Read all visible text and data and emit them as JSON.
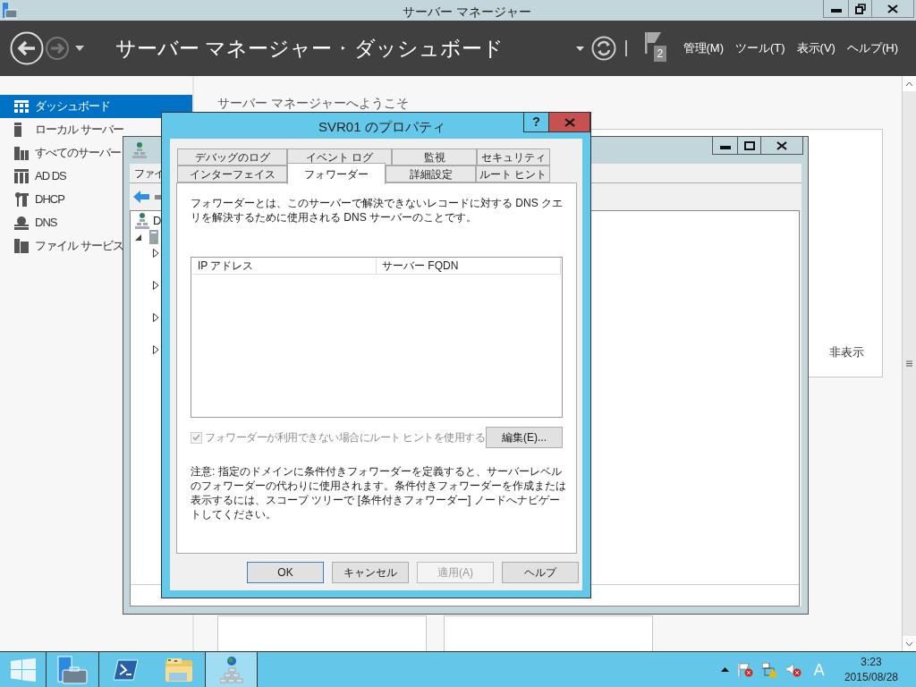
{
  "window": {
    "title": "サーバー マネージャー"
  },
  "header": {
    "breadcrumb": [
      "サーバー マネージャー",
      "ダッシュボード"
    ],
    "breadcrumb_separator": "‣",
    "notification_count": "2",
    "menus": [
      "管理(M)",
      "ツール(T)",
      "表示(V)",
      "ヘルプ(H)"
    ]
  },
  "sidebar": {
    "items": [
      {
        "label": "ダッシュボード",
        "kind": "dashboard",
        "selected": true
      },
      {
        "label": "ローカル サーバー",
        "kind": "server",
        "selected": false
      },
      {
        "label": "すべてのサーバー",
        "kind": "servers",
        "selected": false
      },
      {
        "label": "AD DS",
        "kind": "adds",
        "selected": false
      },
      {
        "label": "DHCP",
        "kind": "dhcp",
        "selected": false
      },
      {
        "label": "DNS",
        "kind": "dns",
        "selected": false
      },
      {
        "label": "ファイル サービス",
        "kind": "files",
        "selected": false
      }
    ]
  },
  "welcome": {
    "title": "サーバー マネージャーへようこそ",
    "hide_link": "非表示"
  },
  "dns_window": {
    "menu": "ファイ",
    "tree": [
      {
        "label": "D",
        "children": [
          {
            "expanded": true,
            "children": [
              {
                "expanded": false
              },
              {
                "expanded": false
              },
              {
                "expanded": false
              },
              {
                "expanded": false
              }
            ]
          }
        ]
      }
    ]
  },
  "dialog": {
    "title": "SVR01 のプロパティ",
    "help_button": "?",
    "tab_rows": [
      [
        {
          "label": "デバッグのログ",
          "selected": false
        },
        {
          "label": "イベント ログ",
          "selected": false
        },
        {
          "label": "監視",
          "selected": false
        },
        {
          "label": "セキュリティ",
          "selected": false
        }
      ],
      [
        {
          "label": "インターフェイス",
          "selected": false
        },
        {
          "label": "フォワーダー",
          "selected": true
        },
        {
          "label": "詳細設定",
          "selected": false
        },
        {
          "label": "ルート ヒント",
          "selected": false
        }
      ]
    ],
    "description": "フォワーダーとは、このサーバーで解決できないレコードに対する DNS クエリを解決するために使用される DNS サーバーのことです。",
    "list": {
      "columns": [
        "IP アドレス",
        "サーバー FQDN"
      ]
    },
    "root_hint_checkbox": {
      "label": "フォワーダーが利用できない場合にルート ヒントを使用する",
      "checked": true,
      "disabled": true
    },
    "edit_button": "編集(E)...",
    "note": "注意: 指定のドメインに条件付きフォワーダーを定義すると、サーバーレベルのフォワーダーの代わりに使用されます。条件付きフォワーダーを作成または表示するには、スコープ ツリーで [条件付きフォワーダー] ノードへナビゲートしてください。",
    "buttons": [
      {
        "label": "OK",
        "default": true,
        "disabled": false
      },
      {
        "label": "キャンセル",
        "default": false,
        "disabled": false
      },
      {
        "label": "適用(A)",
        "default": false,
        "disabled": true
      },
      {
        "label": "ヘルプ",
        "default": false,
        "disabled": false
      }
    ]
  },
  "taskbar": {
    "apps": [
      {
        "kind": "server-manager",
        "selected": false
      },
      {
        "kind": "powershell",
        "selected": false
      },
      {
        "kind": "explorer",
        "selected": false
      },
      {
        "kind": "dns",
        "selected": true
      }
    ],
    "ime": "A",
    "time": "3:23",
    "date": "2015/08/28"
  }
}
